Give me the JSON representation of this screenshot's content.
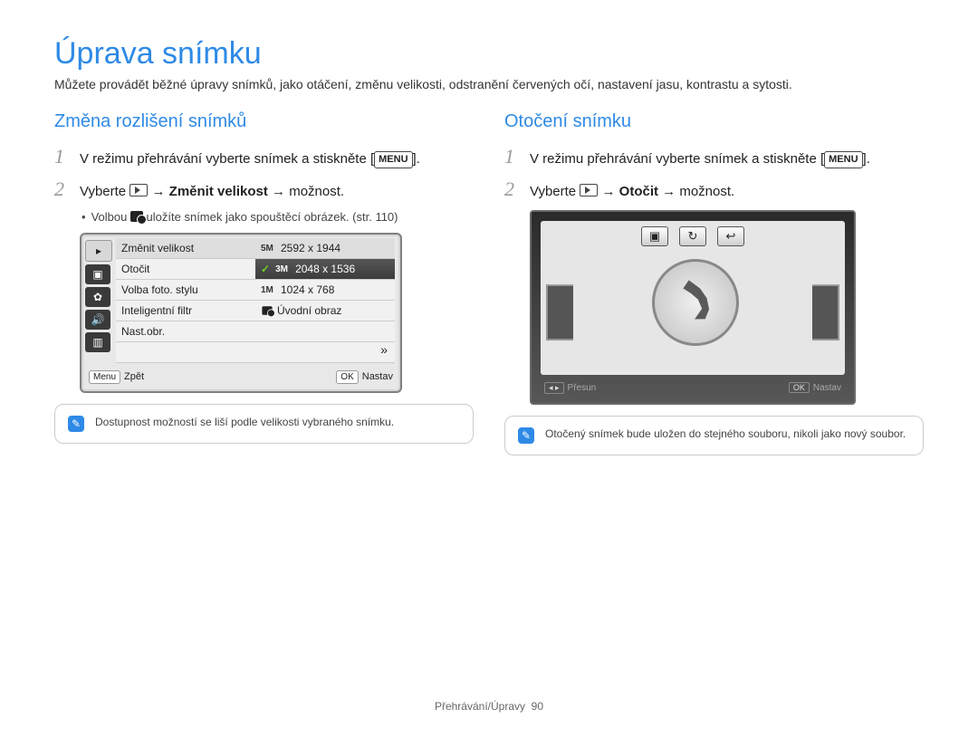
{
  "title": "Úprava snímku",
  "intro": "Můžete provádět běžné úpravy snímků, jako otáčení, změnu velikosti, odstranění červených očí, nastavení jasu, kontrastu a sytosti.",
  "arrow": "→",
  "menu_label": "MENU",
  "left": {
    "heading": "Změna rozlišení snímků",
    "step1": "V režimu přehrávání vyberte snímek a stiskněte [",
    "step1_end": "].",
    "step2_a": "Vyberte ",
    "step2_b": " Změnit velikost ",
    "step2_c": " možnost.",
    "bullet": "Volbou ",
    "bullet_end": " uložíte snímek jako spouštěcí obrázek. (str. 110)",
    "menu": {
      "items": [
        "Změnit velikost",
        "Otočit",
        "Volba foto. stylu",
        "Inteligentní filtr",
        "Nast.obr."
      ],
      "opts": [
        {
          "ico": "5M",
          "label": "2592 x 1944",
          "sel": false
        },
        {
          "ico": "3M",
          "label": "2048 x 1536",
          "sel": true
        },
        {
          "ico": "1M",
          "label": "1024 x 768",
          "sel": false
        },
        {
          "ico": "",
          "label": "Úvodní obraz",
          "sel": false
        }
      ],
      "back_btn": "Menu",
      "back_lbl": "Zpět",
      "ok_btn": "OK",
      "ok_lbl": "Nastav"
    },
    "note": "Dostupnost možností se liší podle velikosti vybraného snímku."
  },
  "right": {
    "heading": "Otočení snímku",
    "step1": "V režimu přehrávání vyberte snímek a stiskněte [",
    "step1_end": "].",
    "step2_a": "Vyberte ",
    "step2_b": " Otočit ",
    "step2_c": " možnost.",
    "rot_footer_left_btn": "◂ ▸",
    "rot_footer_left_lbl": "Přesun",
    "rot_footer_right_btn": "OK",
    "rot_footer_right_lbl": "Nastav",
    "note": "Otočený snímek bude uložen do stejného souboru, nikoli jako nový soubor."
  },
  "footer": {
    "section": "Přehrávání/Úpravy",
    "page": "90"
  }
}
